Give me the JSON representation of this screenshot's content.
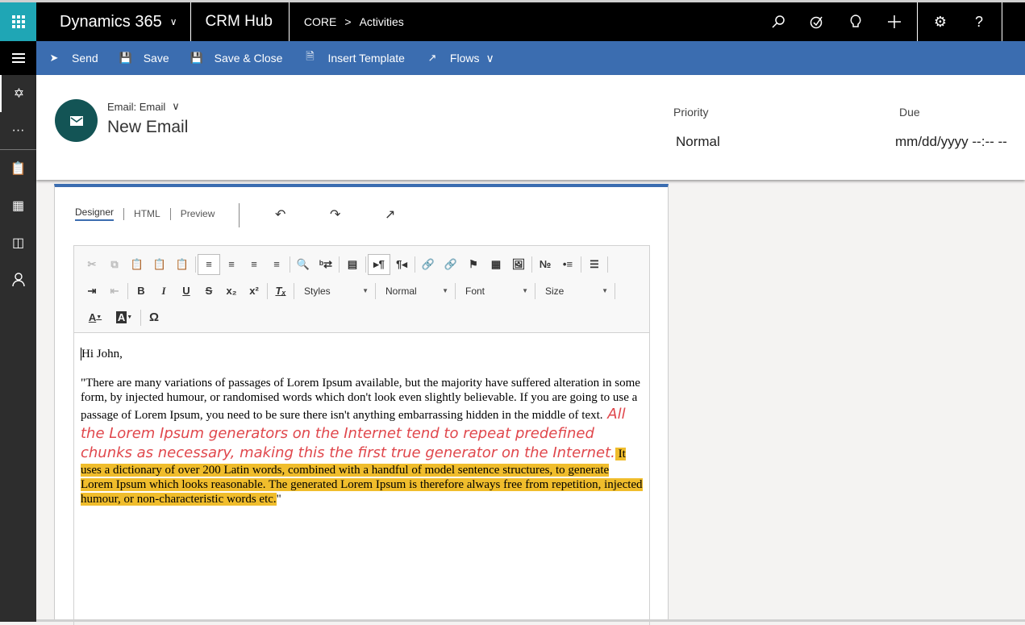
{
  "topbar": {
    "app_name": "Dynamics 365",
    "hub": "CRM Hub",
    "breadcrumb": [
      "CORE",
      "Activities"
    ],
    "breadcrumb_sep": ">",
    "icons": [
      "search-icon",
      "task-icon",
      "lightbulb-icon",
      "plus-icon",
      "gear-icon",
      "help-icon"
    ]
  },
  "commands": [
    {
      "label": "Send",
      "icon": "send-icon"
    },
    {
      "label": "Save",
      "icon": "save-icon"
    },
    {
      "label": "Save & Close",
      "icon": "save-close-icon"
    },
    {
      "label": "Insert Template",
      "icon": "template-icon"
    },
    {
      "label": "Flows",
      "icon": "flows-icon"
    }
  ],
  "header": {
    "entity_type": "Email: Email",
    "title": "New Email",
    "fields": [
      {
        "label": "Priority",
        "value": "Normal"
      },
      {
        "label": "Due",
        "value": "mm/dd/yyyy --:-- --"
      }
    ]
  },
  "editor": {
    "tabs": [
      "Designer",
      "HTML",
      "Preview"
    ],
    "active_tab": "Designer",
    "combos": {
      "styles": "Styles",
      "format": "Normal",
      "font": "Font",
      "size": "Size"
    },
    "body": {
      "greeting": "Hi John,",
      "plain": "\"There are many variations of passages of Lorem Ipsum available, but the majority have suffered alteration in some form, by injected humour, or randomised words which don't look even slightly believable. If you are going to use a passage of Lorem Ipsum, you need to be sure there isn't anything embarrassing hidden in the middle of text.",
      "red_italic": " All the Lorem Ipsum generators on the Internet tend to repeat predefined chunks as necessary, making this the first true generator on the Internet.",
      "highlighted": " It uses a dictionary of over 200 Latin words, combined with a handful of model sentence structures, to generate Lorem Ipsum which looks reasonable. The generated Lorem Ipsum is therefore always free from repetition, injected humour, or non-characteristic words etc.",
      "closing": "\""
    }
  },
  "colors": {
    "accent": "#3b6db0",
    "waffle": "#1fa6b5",
    "avatar": "#135455",
    "highlight": "#f0bd2c",
    "red_text": "#e0474c"
  }
}
